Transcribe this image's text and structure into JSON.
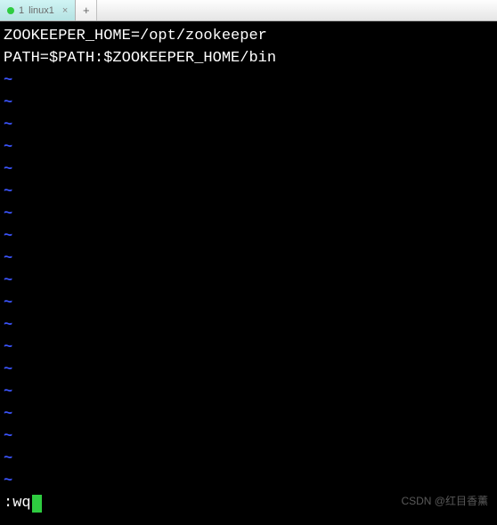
{
  "tabs": {
    "active": {
      "index": "1",
      "title": "linux1",
      "close_symbol": "×"
    },
    "add_symbol": "+"
  },
  "editor": {
    "lines": [
      "ZOOKEEPER_HOME=/opt/zookeeper",
      "PATH=$PATH:$ZOOKEEPER_HOME/bin"
    ],
    "tilde": "~",
    "tilde_count": 19,
    "command": ":wq"
  },
  "watermark": "CSDN @红目香薰"
}
